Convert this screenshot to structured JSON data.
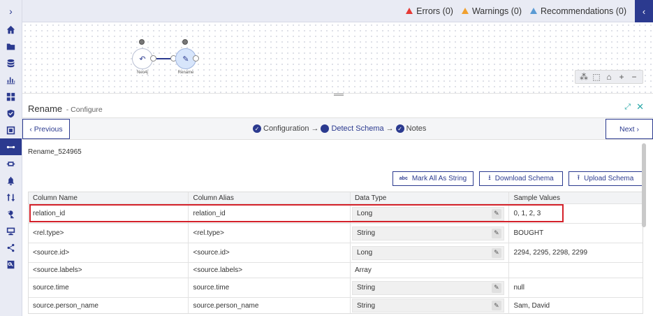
{
  "topbar": {
    "errors": "Errors (0)",
    "warnings": "Warnings (0)",
    "recommendations": "Recommendations (0)",
    "colors": {
      "error": "#e53935",
      "warning": "#f0a030",
      "recommendation": "#5a9bd4"
    }
  },
  "canvas": {
    "nodes": [
      {
        "caption": "Neo4j"
      },
      {
        "caption": "Rename"
      }
    ]
  },
  "panel": {
    "title": "Rename",
    "subtitle": "- Configure"
  },
  "wizard": {
    "prev_label": "Previous",
    "next_label": "Next",
    "steps": [
      "Configuration",
      "Detect Schema",
      "Notes"
    ]
  },
  "schema_name": "Rename_524965",
  "actions": {
    "mark_all": "Mark All As String",
    "download": "Download Schema",
    "upload": "Upload Schema"
  },
  "table": {
    "headers": [
      "Column Name",
      "Column Alias",
      "Data Type",
      "Sample Values"
    ],
    "rows": [
      [
        "relation_id",
        "relation_id",
        "Long",
        "0, 1, 2, 3"
      ],
      [
        "<rel.type>",
        "<rel.type>",
        "String",
        "BOUGHT"
      ],
      [
        "<source.id>",
        "<source.id>",
        "Long",
        "2294, 2295, 2298, 2299"
      ],
      [
        "<source.labels>",
        "<source.labels>",
        "Array",
        ""
      ],
      [
        "source.time",
        "source.time",
        "String",
        "null"
      ],
      [
        "source.person_name",
        "source.person_name",
        "String",
        "Sam, David"
      ]
    ]
  },
  "accent_color": "#2b3a8f"
}
